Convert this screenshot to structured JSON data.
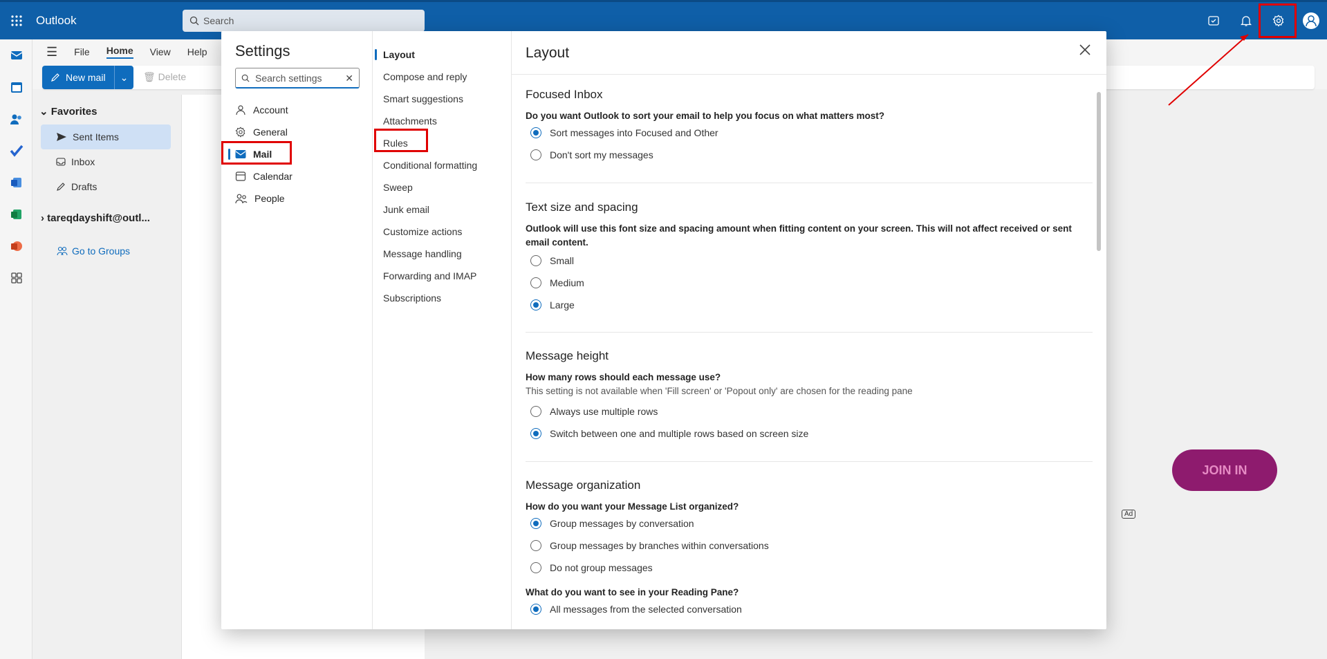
{
  "app": {
    "title": "Outlook"
  },
  "search": {
    "placeholder": "Search"
  },
  "ribbon": {
    "tabs": [
      "File",
      "Home",
      "View",
      "Help"
    ],
    "active_tab": "Home",
    "new_mail_label": "New mail",
    "delete_label": "Delete"
  },
  "folders": {
    "favorites_label": "Favorites",
    "items": [
      {
        "label": "Sent Items",
        "icon": "send-icon",
        "selected": true
      },
      {
        "label": "Inbox",
        "icon": "inbox-icon",
        "selected": false
      },
      {
        "label": "Drafts",
        "icon": "drafts-icon",
        "selected": false
      }
    ],
    "account_label": "tareqdayshift@outl...",
    "groups_label": "Go to Groups"
  },
  "ad": {
    "join_label": "JOIN IN",
    "ad_badge": "Ad"
  },
  "settings": {
    "title": "Settings",
    "search_placeholder": "Search settings",
    "nav": [
      {
        "label": "Account",
        "icon": "person-icon"
      },
      {
        "label": "General",
        "icon": "gear-icon"
      },
      {
        "label": "Mail",
        "icon": "mail-icon",
        "selected": true
      },
      {
        "label": "Calendar",
        "icon": "calendar-icon"
      },
      {
        "label": "People",
        "icon": "people-icon"
      }
    ],
    "mail_nav": [
      "Layout",
      "Compose and reply",
      "Smart suggestions",
      "Attachments",
      "Rules",
      "Conditional formatting",
      "Sweep",
      "Junk email",
      "Customize actions",
      "Message handling",
      "Forwarding and IMAP",
      "Subscriptions"
    ],
    "content_title": "Layout",
    "sections": {
      "focused": {
        "title": "Focused Inbox",
        "question": "Do you want Outlook to sort your email to help you focus on what matters most?",
        "options": [
          "Sort messages into Focused and Other",
          "Don't sort my messages"
        ],
        "selected": 0
      },
      "text_size": {
        "title": "Text size and spacing",
        "question": "Outlook will use this font size and spacing amount when fitting content on your screen. This will not affect received or sent email content.",
        "options": [
          "Small",
          "Medium",
          "Large"
        ],
        "selected": 2
      },
      "height": {
        "title": "Message height",
        "question": "How many rows should each message use?",
        "note": "This setting is not available when 'Fill screen' or 'Popout only' are chosen for the reading pane",
        "options": [
          "Always use multiple rows",
          "Switch between one and multiple rows based on screen size"
        ],
        "selected": 1
      },
      "organization": {
        "title": "Message organization",
        "question": "How do you want your Message List organized?",
        "options": [
          "Group messages by conversation",
          "Group messages by branches within conversations",
          "Do not group messages"
        ],
        "selected": 0,
        "reading_question": "What do you want to see in your Reading Pane?",
        "reading_options": [
          "All messages from the selected conversation"
        ],
        "reading_selected": 0
      }
    }
  },
  "colors": {
    "brand": "#0f5fa8",
    "accent": "#0f6cbd",
    "highlight": "#e00000"
  }
}
